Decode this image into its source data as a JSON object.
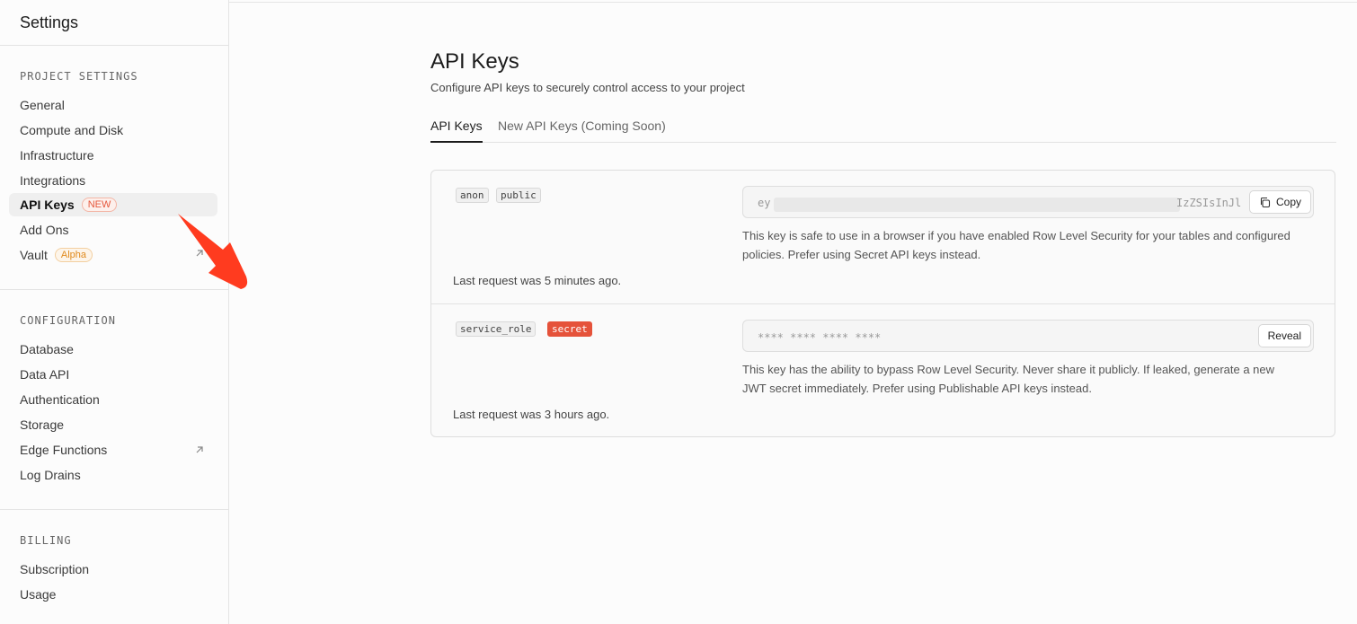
{
  "sidebar": {
    "title": "Settings",
    "sections": [
      {
        "heading": "PROJECT SETTINGS"
      },
      {
        "heading": "CONFIGURATION"
      },
      {
        "heading": "BILLING"
      }
    ],
    "project_items": [
      "General",
      "Compute and Disk",
      "Infrastructure",
      "Integrations",
      "API Keys",
      "Add Ons",
      "Vault"
    ],
    "api_keys_badge": "NEW",
    "vault_badge": "Alpha",
    "config_items": [
      "Database",
      "Data API",
      "Authentication",
      "Storage",
      "Edge Functions",
      "Log Drains"
    ],
    "billing_items": [
      "Subscription",
      "Usage"
    ]
  },
  "main": {
    "title": "API Keys",
    "subtitle": "Configure API keys to securely control access to your project",
    "tabs": [
      "API Keys",
      "New API Keys (Coming Soon)"
    ],
    "keys": [
      {
        "tags": [
          "anon",
          "public"
        ],
        "value_start": "ey",
        "value_end": "IzZSIsInJl",
        "button": "Copy",
        "description": "This key is safe to use in a browser if you have enabled Row Level Security for your tables and configured policies. Prefer using Secret API keys instead.",
        "last_request": "Last request was 5 minutes ago."
      },
      {
        "tags": [
          "service_role",
          "secret"
        ],
        "value_masked": "**** **** **** ****",
        "button": "Reveal",
        "description": "This key has the ability to bypass Row Level Security. Never share it publicly. If leaked, generate a new JWT secret immediately. Prefer using Publishable API keys instead.",
        "last_request": "Last request was 3 hours ago."
      }
    ]
  },
  "colors": {
    "accent_red": "#e5523a",
    "annotation_arrow": "#ff3b1f"
  }
}
